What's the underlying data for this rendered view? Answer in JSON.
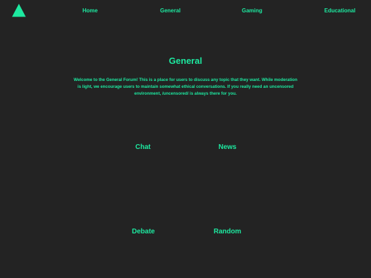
{
  "colors": {
    "background": "#232323",
    "accent": "#1de9a0"
  },
  "header": {
    "logo_icon": "triangle-logo-icon",
    "nav": {
      "home": "Home",
      "general": "General",
      "gaming": "Gaming",
      "educational": "Educational"
    }
  },
  "main": {
    "title": "General",
    "intro": "Welcome to the General Forum! This is a place for users to discuss any topic that they want. While moderation is light, we encourage users to maintain somewhat ethical conversations. If you really need an uncensored environment, /uncensored/ is always there for you.",
    "categories": {
      "chat": "Chat",
      "news": "News",
      "debate": "Debate",
      "random": "Random"
    }
  }
}
